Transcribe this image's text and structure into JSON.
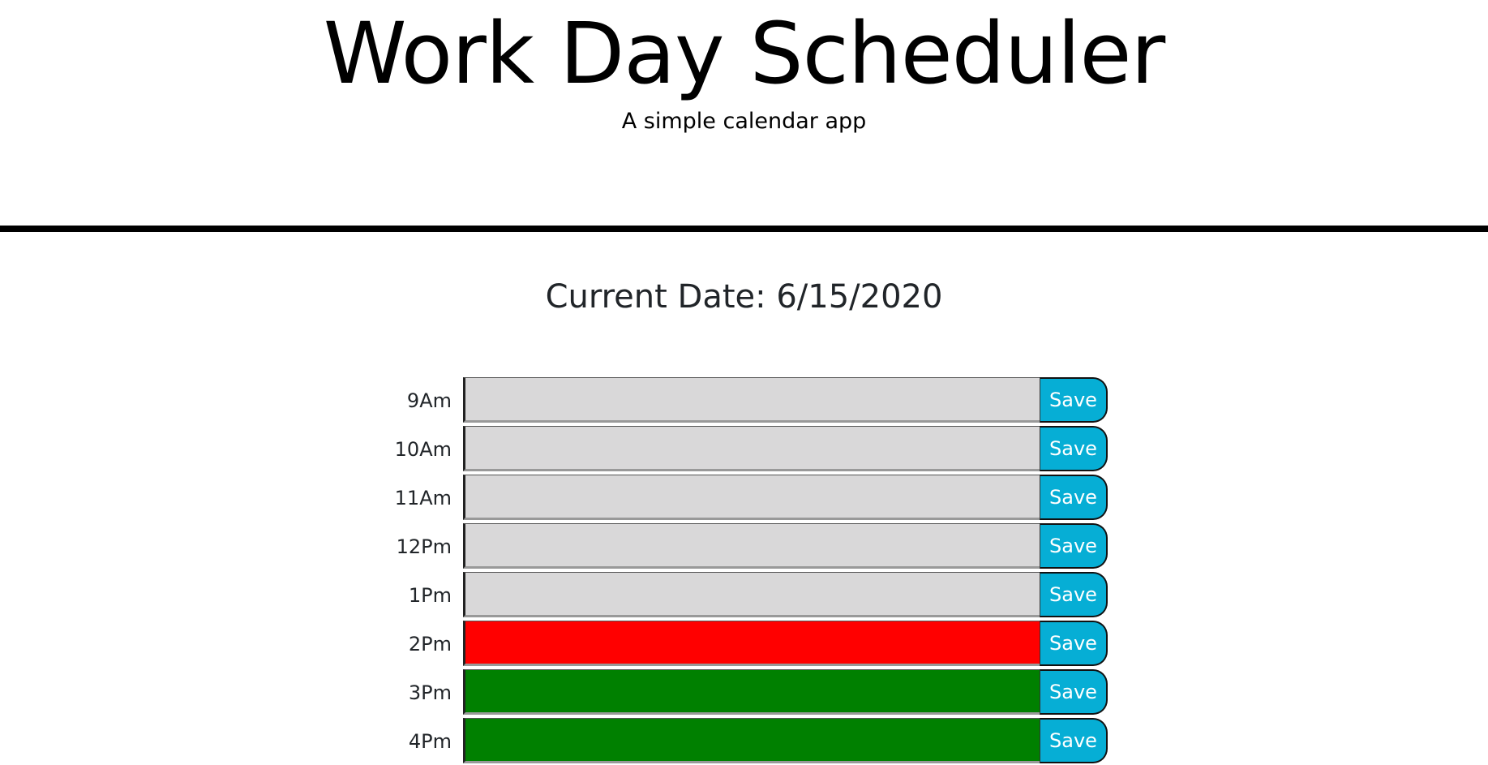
{
  "header": {
    "title": "Work Day Scheduler",
    "subtitle": "A simple calendar app"
  },
  "current_date": {
    "label": "Current Date:",
    "value": "6/15/2020"
  },
  "colors": {
    "past": "#d9d8d9",
    "present": "#ff0000",
    "future": "#008000",
    "save_button": "#06aed5"
  },
  "time_blocks": [
    {
      "hour": "9Am",
      "status": "past",
      "text": "",
      "save_label": "Save"
    },
    {
      "hour": "10Am",
      "status": "past",
      "text": "",
      "save_label": "Save"
    },
    {
      "hour": "11Am",
      "status": "past",
      "text": "",
      "save_label": "Save"
    },
    {
      "hour": "12Pm",
      "status": "past",
      "text": "",
      "save_label": "Save"
    },
    {
      "hour": "1Pm",
      "status": "past",
      "text": "",
      "save_label": "Save"
    },
    {
      "hour": "2Pm",
      "status": "present",
      "text": "",
      "save_label": "Save"
    },
    {
      "hour": "3Pm",
      "status": "future",
      "text": "",
      "save_label": "Save"
    },
    {
      "hour": "4Pm",
      "status": "future",
      "text": "",
      "save_label": "Save"
    }
  ]
}
